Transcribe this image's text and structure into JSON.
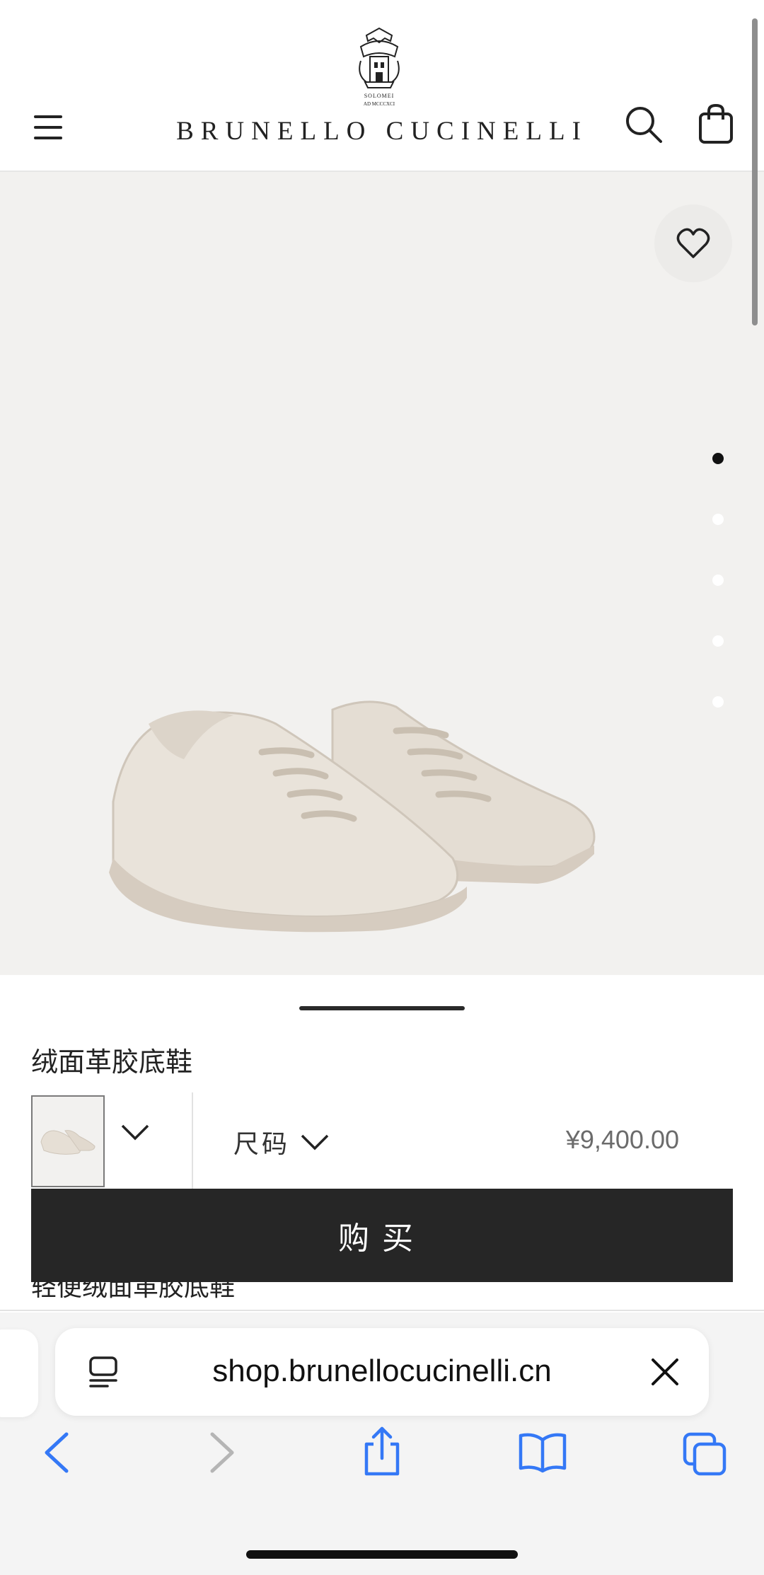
{
  "header": {
    "brand": "BRUNELLO CUCINELLI",
    "logo_small_text": "SOLOMEI",
    "logo_date": "AD MCCCXCI",
    "menu_icon": "hamburger-icon",
    "search_icon": "search-icon",
    "bag_icon": "shopping-bag-icon"
  },
  "gallery": {
    "wishlist_icon": "heart-icon",
    "image_count": 5,
    "active_index": 1
  },
  "product": {
    "name": "绒面革胶底鞋",
    "size_label": "尺码",
    "price": "¥9,400.00",
    "buy_label": "购买",
    "description_peek": "轻便绒面革胶底鞋"
  },
  "browser": {
    "url": "shop.brunellocucinelli.cn",
    "reader_icon": "reader-icon",
    "close_icon": "close-icon",
    "toolbar": [
      "back-icon",
      "forward-icon",
      "share-icon",
      "bookmarks-icon",
      "tabs-icon"
    ]
  },
  "colors": {
    "accent": "#262626",
    "image_bg": "#f2f1ef",
    "safari_blue": "#3478f6"
  }
}
